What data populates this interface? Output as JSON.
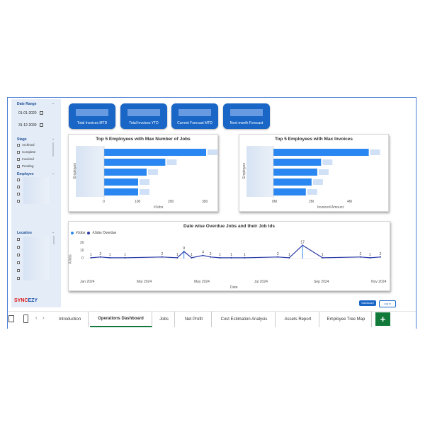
{
  "sidebar": {
    "date_range_label": "Date Range",
    "date_start": "01-01-2020",
    "date_end": "31-12-2030",
    "stage_label": "Stage",
    "stages": [
      "Archived",
      "Complete",
      "Invoiced",
      "Pending"
    ],
    "employee_label": "Employee",
    "location_label": "Location"
  },
  "kpis": [
    "Total Invoices MTD",
    "Total Invoices YTD",
    "Current Forecast MTD",
    "Next month Forecast"
  ],
  "chart1": {
    "title": "Top 5 Employees with Max Number of Jobs",
    "xlabel": "#Jobs",
    "ylabel": "Employee",
    "ticks": [
      "0",
      "100",
      "200",
      "300"
    ]
  },
  "chart2": {
    "title": "Top 5 Employees with Max Invoices",
    "xlabel": "Invoiced Amount",
    "ylabel": "Employee",
    "ticks": [
      "0M",
      "2M",
      "4M"
    ]
  },
  "chart3": {
    "title": "Date wise Overdue Jobs and their Job Ids",
    "legend": [
      "#Jobs",
      "#Jobs Overdue"
    ],
    "xlabel": "Date",
    "ylabel": "#Jobs",
    "yticks": [
      "0",
      "10",
      "20"
    ],
    "xticks": [
      "Jan 2024",
      "Mar 2024",
      "May 2024",
      "Jul 2024",
      "Sep 2024",
      "Nov 2024"
    ]
  },
  "logo": {
    "text_a": "SYNC",
    "text_b": "EZY"
  },
  "buttons": {
    "first": "Dashboard",
    "second": "Log In"
  },
  "tabs": [
    "Introduction",
    "Operations Dashboard",
    "Jobs",
    "Net Profit",
    "Cost Estimation Analysis",
    "Assets Report",
    "Employee Tree Map"
  ],
  "add_tab_label": "+",
  "colors": {
    "accent": "#1966c6",
    "bar": "#2a86f0",
    "line": "#2a3aa8",
    "active_tab": "#117a3b"
  },
  "chart_data": [
    {
      "type": "bar",
      "title": "Top 5 Employees with Max Number of Jobs",
      "xlabel": "#Jobs",
      "ylabel": "Employee",
      "categories": [
        "",
        "",
        "",
        "",
        ""
      ],
      "values": [
        300,
        180,
        125,
        100,
        100
      ],
      "xlim": [
        0,
        300
      ]
    },
    {
      "type": "bar",
      "title": "Top 5 Employees with Max Invoices",
      "xlabel": "Invoiced Amount",
      "ylabel": "Employee",
      "categories": [
        "",
        "",
        "",
        "",
        ""
      ],
      "values": [
        5.0,
        2.5,
        2.3,
        2.0,
        1.7
      ],
      "xlim": [
        0,
        5.2
      ]
    },
    {
      "type": "line",
      "title": "Date wise Overdue Jobs and their Job Ids",
      "xlabel": "Date",
      "ylabel": "#Jobs",
      "ylim": [
        0,
        20
      ],
      "series": [
        {
          "name": "#Jobs",
          "x": [
            "2024-01-05",
            "2024-01-15",
            "2024-01-25",
            "2024-02-10",
            "2024-03-20",
            "2024-04-05",
            "2024-04-12",
            "2024-04-20",
            "2024-05-02",
            "2024-05-10",
            "2024-05-20",
            "2024-06-01",
            "2024-06-15",
            "2024-07-20",
            "2024-08-01",
            "2024-08-15",
            "2024-09-05",
            "2024-10-15",
            "2024-10-25",
            "2024-11-05"
          ],
          "values": [
            1,
            2,
            1,
            1,
            2,
            1,
            9,
            1,
            4,
            2,
            1,
            1,
            1,
            2,
            1,
            17,
            1,
            2,
            1,
            2
          ]
        }
      ]
    }
  ]
}
